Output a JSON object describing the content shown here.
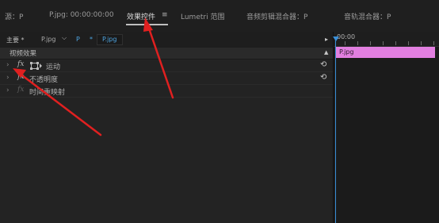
{
  "tabs": [
    {
      "label": "源：P"
    },
    {
      "label": "P.jpg: 00:00:00:00"
    },
    {
      "label": "效果控件"
    },
    {
      "label": "Lumetri 范围"
    },
    {
      "label": "音频剪辑混合器：P"
    },
    {
      "label": "音轨混合器：P"
    }
  ],
  "tab_menu_glyph": "≡",
  "subheader": {
    "master_label": "主要 *",
    "clip_name": "P.jpg",
    "dropdown_glyph": "⌵",
    "sequence_name": "P",
    "sequence_star": "*",
    "clip_chip": "P.jpg"
  },
  "effects": {
    "header": "视频效果",
    "items": [
      {
        "label": "运动",
        "fx": "fx",
        "has_reset": true
      },
      {
        "label": "不透明度",
        "fx": "fx",
        "has_reset": true
      },
      {
        "label": "时间重映射",
        "fx": "fx",
        "has_reset": false
      }
    ]
  },
  "timeline": {
    "timecode": "00:00",
    "clip_label": "P.jpg"
  },
  "colors": {
    "playhead": "#3a8fd8",
    "clip": "#e27fe0",
    "annotation": "#e02020"
  }
}
